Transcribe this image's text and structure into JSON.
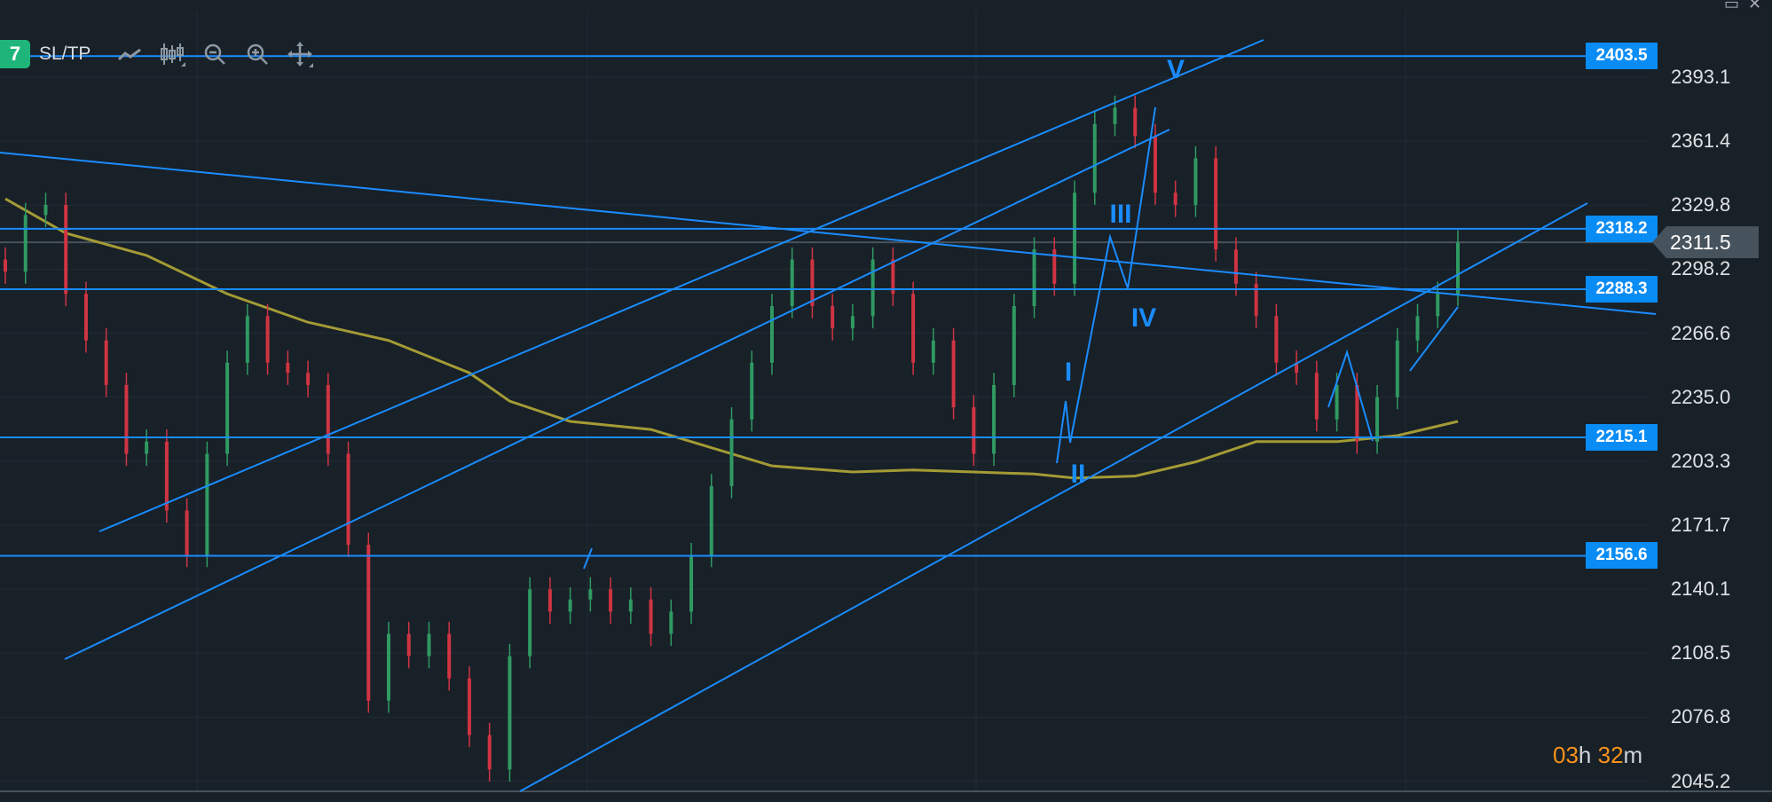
{
  "toolbar": {
    "badge": "7",
    "sltp_label": "SL/TP",
    "icons": [
      "line-chart-icon",
      "candlestick-icon",
      "zoom-out-icon",
      "zoom-in-icon",
      "move-icon"
    ]
  },
  "window_controls": {
    "minimize": "▭",
    "close": "✕"
  },
  "timer": {
    "hours": "03",
    "h": "h",
    "minutes": "32",
    "m": "m"
  },
  "colors": {
    "background": "#182028",
    "up": "#2f9a62",
    "down": "#cf3442",
    "drawing": "#1a8cff",
    "ma": "#a39b35",
    "timer": "#f7931a"
  },
  "chart_data": {
    "type": "candlestick",
    "ylim": [
      2045.2,
      2403.5
    ],
    "y_ticks": [
      "2393.1",
      "2361.4",
      "2329.8",
      "2298.2",
      "2266.6",
      "2235.0",
      "2203.3",
      "2171.7",
      "2140.1",
      "2108.5",
      "2076.8",
      "2045.2"
    ],
    "current_price": "2311.5",
    "horizontal_levels": [
      "2403.5",
      "2318.2",
      "2288.3",
      "2215.1",
      "2156.6"
    ],
    "closes": [
      2297,
      2325,
      2330,
      2286,
      2263,
      2241,
      2207,
      2213,
      2179,
      2157,
      2207,
      2252,
      2275,
      2252,
      2247,
      2241,
      2207,
      2162,
      2085,
      2118,
      2107,
      2118,
      2096,
      2068,
      2051,
      2107,
      2140,
      2129,
      2135,
      2140,
      2129,
      2135,
      2118,
      2129,
      2157,
      2191,
      2224,
      2252,
      2280,
      2303,
      2280,
      2269,
      2275,
      2303,
      2286,
      2252,
      2263,
      2230,
      2207,
      2241,
      2280,
      2308,
      2291,
      2336,
      2370,
      2378,
      2364,
      2336,
      2330,
      2353,
      2308,
      2291,
      2275,
      2252,
      2247,
      2224,
      2241,
      2213,
      2235,
      2263,
      2275,
      2286,
      2311.5
    ],
    "moving_average": [
      [
        0,
        2333
      ],
      [
        3,
        2316
      ],
      [
        7,
        2305
      ],
      [
        11,
        2286
      ],
      [
        15,
        2272
      ],
      [
        19,
        2263
      ],
      [
        23,
        2247
      ],
      [
        25,
        2233
      ],
      [
        28,
        2223
      ],
      [
        32,
        2219
      ],
      [
        35,
        2210
      ],
      [
        38,
        2201
      ],
      [
        42,
        2198
      ],
      [
        45,
        2199
      ],
      [
        48,
        2198
      ],
      [
        51,
        2197
      ],
      [
        53,
        2195
      ],
      [
        56,
        2196
      ],
      [
        59,
        2203
      ],
      [
        62,
        2213
      ],
      [
        66,
        2213
      ],
      [
        69,
        2216
      ],
      [
        72,
        2223
      ]
    ],
    "wave_labels": [
      "I",
      "II",
      "III",
      "IV",
      "V"
    ]
  }
}
